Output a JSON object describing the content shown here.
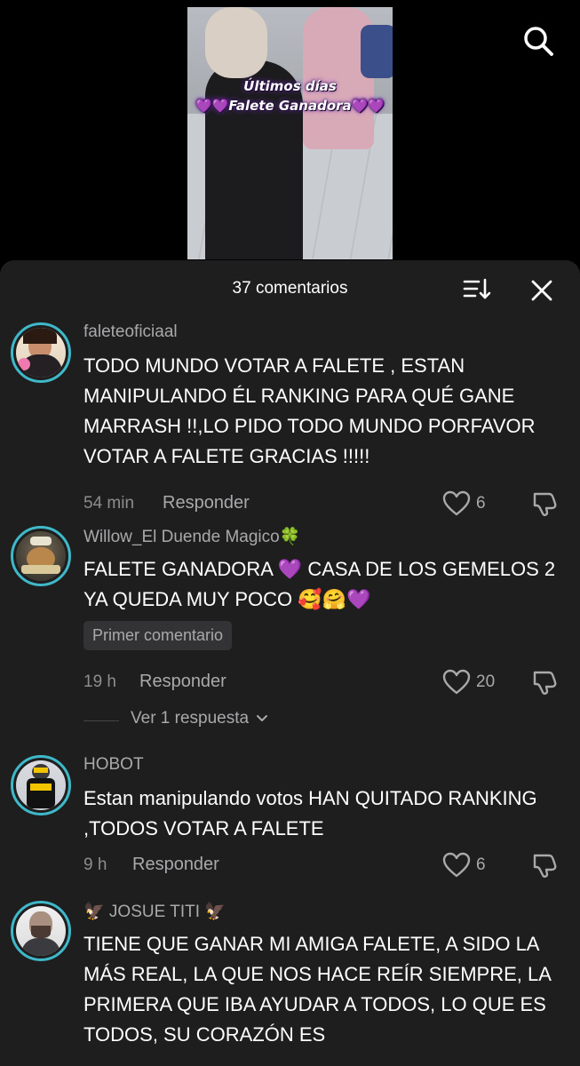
{
  "video": {
    "overlay_line1": "Últimos días",
    "overlay_line2": "Falete Ganadora",
    "hearts_left": "💜💜",
    "hearts_right": "💜💜"
  },
  "header": {
    "title": "37 comentarios"
  },
  "comments": [
    {
      "username": "faleteoficiaal",
      "text": "TODO MUNDO VOTAR A FALETE , ESTAN MANIPULANDO ÉL RANKING PARA QUÉ GANE MARRASH !!,LO PIDO TODO MUNDO PORFAVOR VOTAR A FALETE GRACIAS !!!!!",
      "time": "54 min",
      "reply_label": "Responder",
      "likes": "6"
    },
    {
      "username": "Willow_El Duende Magico🍀",
      "text": "FALETE GANADORA 💜 CASA DE LOS GEMELOS 2 YA QUEDA MUY POCO 🥰🤗💜",
      "badge": "Primer comentario",
      "time": "19 h",
      "reply_label": "Responder",
      "likes": "20",
      "replies_link": "Ver 1 respuesta"
    },
    {
      "username": "HOBOT",
      "text": "Estan manipulando votos HAN QUITADO RANKING ,TODOS VOTAR A FALETE",
      "time": "9 h",
      "reply_label": "Responder",
      "likes": "6"
    },
    {
      "username": "🦅 JOSUE TITI 🦅",
      "text": "TIENE QUE GANAR MI AMIGA FALETE, A SIDO LA MÁS REAL, LA QUE NOS HACE REÍR SIEMPRE, LA PRIMERA QUE IBA AYUDAR A TODOS, LO QUE ES TODOS, SU CORAZÓN ES"
    }
  ],
  "colors": {
    "panel_bg": "#1e1e1f",
    "avatar_ring": "#3fb9c9",
    "text_primary": "#ffffff",
    "text_secondary": "#a9a9ab",
    "text_muted": "#8d8d90"
  },
  "icons": {
    "search": "search-icon",
    "sort": "sort-icon",
    "close": "close-icon",
    "like": "heart-icon",
    "dislike": "thumbs-down-icon",
    "chevron": "chevron-down-icon"
  }
}
